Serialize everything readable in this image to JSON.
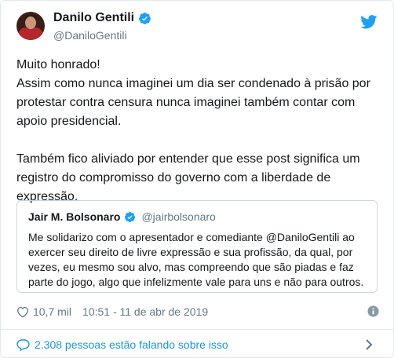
{
  "tweet": {
    "author": {
      "name": "Danilo Gentili",
      "handle": "@DaniloGentili"
    },
    "paragraphs": [
      "Muito honrado!",
      "Assim como nunca imaginei um dia ser condenado à prisão por protestar contra censura nunca imaginei também contar com apoio presidencial.",
      "Também fico aliviado por entender que esse post significa um registro do compromisso do governo com a liberdade de expressão."
    ]
  },
  "quote": {
    "name": "Jair M. Bolsonaro",
    "handle": "@jairbolsonaro",
    "text": "Me solidarizo com o apresentador e comediante @DaniloGentili ao exercer seu direito de livre expressão e sua profissão, da qual, por vezes, eu mesmo sou alvo, mas compreendo que são piadas e faz parte do jogo, algo que infelizmente vale para uns e não para outros."
  },
  "meta": {
    "likes": "10,7 mil",
    "timestamp": "10:51 - 11 de abr de 2019"
  },
  "footer": {
    "talking": "2.308 pessoas estão falando sobre isso"
  },
  "icons": {
    "verified": "verified-badge-icon",
    "logo": "twitter-bird-icon",
    "like": "heart-icon",
    "info": "info-icon",
    "conversation": "speech-bubble-icon",
    "chevron": "chevron-right-icon"
  },
  "colors": {
    "accent": "#1da1f2",
    "link": "#1b95e0",
    "secondary_text": "#657786",
    "border": "#e1e8ed"
  }
}
